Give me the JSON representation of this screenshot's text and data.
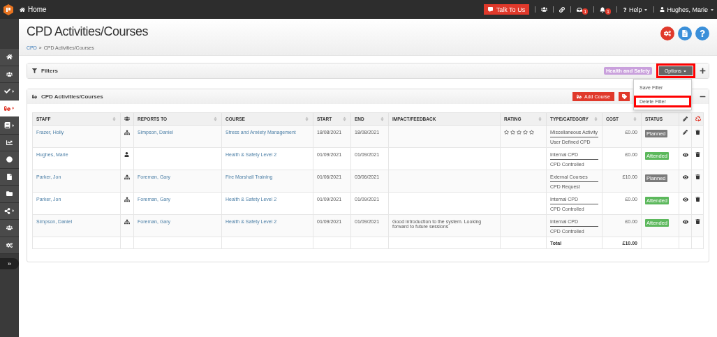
{
  "topbar": {
    "home": "Home",
    "talk": "Talk To Us",
    "inbox_badge": "1",
    "bell_badge": "1",
    "help": "Help",
    "user": "Hughes, Marie"
  },
  "sidebar": {
    "items": [
      {
        "kind": "home",
        "selected": false,
        "submenu": false
      },
      {
        "kind": "users",
        "selected": false,
        "submenu": false
      },
      {
        "kind": "check",
        "selected": false,
        "submenu": true
      },
      {
        "kind": "pill",
        "selected": true,
        "submenu": true
      },
      {
        "kind": "book",
        "selected": false,
        "submenu": true
      },
      {
        "kind": "chart",
        "selected": false,
        "submenu": false
      },
      {
        "kind": "circle",
        "selected": false,
        "submenu": false
      },
      {
        "kind": "file",
        "selected": false,
        "submenu": false
      },
      {
        "kind": "folder",
        "selected": false,
        "submenu": false
      },
      {
        "kind": "share",
        "selected": false,
        "submenu": true
      },
      {
        "kind": "users",
        "selected": false,
        "submenu": false
      },
      {
        "kind": "cogs",
        "selected": false,
        "submenu": false
      }
    ],
    "expand": "»"
  },
  "page": {
    "title": "CPD Activities/Courses",
    "breadcrumb": {
      "link": "CPD",
      "separator": "»",
      "current": "CPD Activities/Courses"
    }
  },
  "filters": {
    "title": "Filters",
    "tag": "Health and Safety",
    "options": "Options",
    "options_highlighted": true,
    "menu": [
      {
        "label": "Save Filter",
        "highlighted": false
      },
      {
        "label": "Delete Filter",
        "highlighted": true
      }
    ]
  },
  "panel": {
    "title": "CPD Activities/Courses",
    "add_button": "Add Course"
  },
  "table": {
    "columns": [
      {
        "kind": "text",
        "label": "STAFF",
        "sortable": true
      },
      {
        "kind": "users"
      },
      {
        "kind": "text",
        "label": "REPORTS TO",
        "sortable": true
      },
      {
        "kind": "text",
        "label": "COURSE",
        "sortable": true
      },
      {
        "kind": "text",
        "label": "START",
        "sortable": true
      },
      {
        "kind": "text",
        "label": "END",
        "sortable": true
      },
      {
        "kind": "text",
        "label": "IMPACT/FEEDBACK",
        "sortable": false
      },
      {
        "kind": "text",
        "label": "RATING",
        "sortable": true
      },
      {
        "kind": "text",
        "label": "TYPE/CATEGORY",
        "sortable": true
      },
      {
        "kind": "text",
        "label": "COST",
        "sortable": true
      },
      {
        "kind": "text",
        "label": "STATUS",
        "sortable": false
      },
      {
        "kind": "pencil"
      },
      {
        "kind": "recycle"
      }
    ],
    "rows": [
      {
        "staff": "Frazer, Holly",
        "report": {
          "kind": "team"
        },
        "reports_to": "Simpson, Daniel",
        "course": "Stress and Anxiety Management",
        "start": "18/08/2021",
        "end": "18/08/2021",
        "stars": 0,
        "type": "Miscellaneous Activity",
        "category": "User Defined CPD",
        "cost": "£0.00",
        "status": {
          "label": "Planned",
          "kind": "planned"
        },
        "action": {
          "kind": "edit"
        }
      },
      {
        "staff": "Hughes, Marie",
        "report": {
          "kind": "person"
        },
        "course": "Health & Safety Level 2",
        "start": "01/09/2021",
        "end": "01/09/2021",
        "type": "Internal CPD",
        "category": "CPD Controlled",
        "cost": "£0.00",
        "status": {
          "label": "Attended",
          "kind": "attended"
        },
        "action": {
          "kind": "view"
        }
      },
      {
        "staff": "Parker, Jon",
        "report": {
          "kind": "team"
        },
        "reports_to": "Foreman, Gary",
        "course": "Fire Marshall Training",
        "start": "01/06/2021",
        "end": "03/06/2021",
        "type": "External Courses",
        "category": "CPD Request",
        "cost": "£10.00",
        "status": {
          "label": "Planned",
          "kind": "planned"
        },
        "action": {
          "kind": "view"
        }
      },
      {
        "staff": "Parker, Jon",
        "report": {
          "kind": "team"
        },
        "reports_to": "Foreman, Gary",
        "course": "Health & Safety Level 2",
        "start": "01/09/2021",
        "end": "01/09/2021",
        "type": "Internal CPD",
        "category": "CPD Controlled",
        "cost": "£0.00",
        "status": {
          "label": "Attended",
          "kind": "attended"
        },
        "action": {
          "kind": "view"
        }
      },
      {
        "staff": "Simpson, Daniel",
        "report": {
          "kind": "team"
        },
        "reports_to": "Foreman, Gary",
        "course": "Health & Safety Level 2",
        "start": "01/09/2021",
        "end": "01/09/2021",
        "impact": "Good introduction to the system. Looking forward to future sessions",
        "type": "Internal CPD",
        "category": "CPD Controlled",
        "cost": "£0.00",
        "status": {
          "label": "Attended",
          "kind": "attended"
        },
        "action": {
          "kind": "view"
        }
      }
    ],
    "total_label": "Total",
    "total": "£10.00"
  }
}
